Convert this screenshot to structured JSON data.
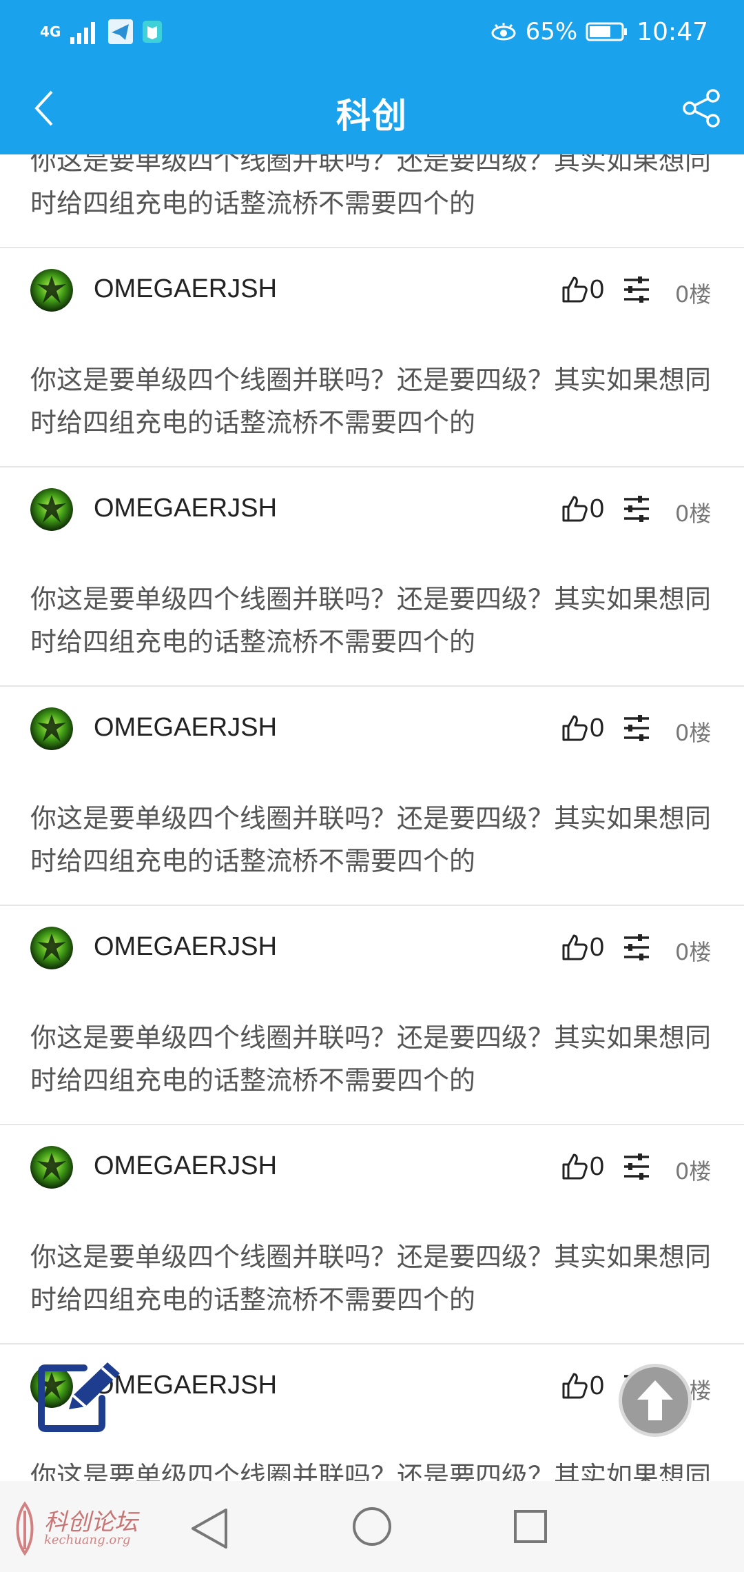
{
  "status_bar": {
    "network": "4G",
    "battery_percent": "65%",
    "time": "10:47"
  },
  "app_bar": {
    "title": "科创"
  },
  "top_partial_post": {
    "body": "你这是要单级四个线圈并联吗？还是要四级？其实如果想同时给四组充电的话整流桥不需要四个的"
  },
  "posts": [
    {
      "username": "OMEGAERJSH",
      "likes": "0",
      "floor": "0楼",
      "body": "你这是要单级四个线圈并联吗？还是要四级？其实如果想同时给四组充电的话整流桥不需要四个的"
    },
    {
      "username": "OMEGAERJSH",
      "likes": "0",
      "floor": "0楼",
      "body": "你这是要单级四个线圈并联吗？还是要四级？其实如果想同时给四组充电的话整流桥不需要四个的"
    },
    {
      "username": "OMEGAERJSH",
      "likes": "0",
      "floor": "0楼",
      "body": "你这是要单级四个线圈并联吗？还是要四级？其实如果想同时给四组充电的话整流桥不需要四个的"
    },
    {
      "username": "OMEGAERJSH",
      "likes": "0",
      "floor": "0楼",
      "body": "你这是要单级四个线圈并联吗？还是要四级？其实如果想同时给四组充电的话整流桥不需要四个的"
    },
    {
      "username": "OMEGAERJSH",
      "likes": "0",
      "floor": "0楼",
      "body": "你这是要单级四个线圈并联吗？还是要四级？其实如果想同时给四组充电的话整流桥不需要四个的"
    },
    {
      "username": "OMEGAERJSH",
      "likes": "0",
      "floor": "0楼",
      "body": "你这是要单级四个线圈并联吗？还是要四级？其实如果想同时给四组充电的话整流桥不需要四个的"
    }
  ],
  "watermark": {
    "title": "科创论坛",
    "site": "kechuang.org"
  },
  "colors": {
    "accent": "#1aa3ec",
    "fab_edit": "#1f3d8f",
    "fab_top": "#9c9c9c"
  },
  "icons": {
    "back": "chevron-left-icon",
    "share": "share-icon",
    "like": "thumbs-up-icon",
    "filter": "sliders-icon",
    "edit": "edit-icon",
    "scroll_top": "arrow-up-icon"
  }
}
